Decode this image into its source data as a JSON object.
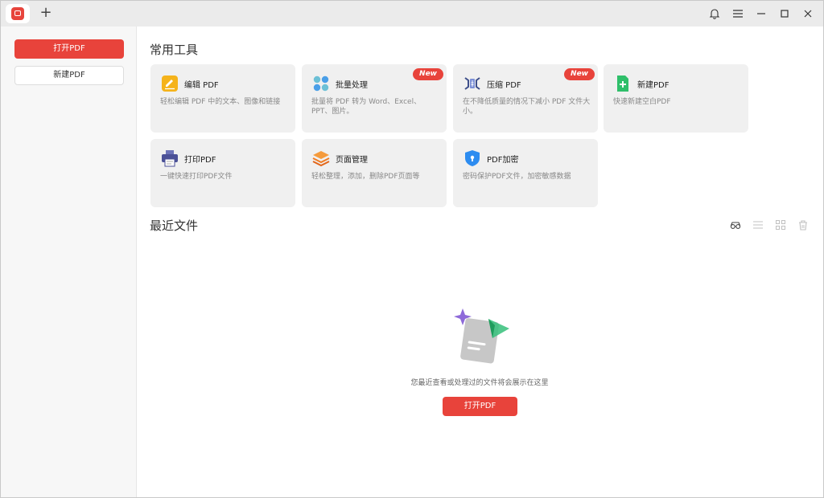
{
  "titlebar": {
    "new_tab": "+"
  },
  "sidebar": {
    "open_pdf": "打开PDF",
    "new_pdf": "新建PDF"
  },
  "tools": {
    "heading": "常用工具",
    "items": [
      {
        "title": "编辑 PDF",
        "desc": "轻松编辑 PDF 中的文本、图像和链接",
        "badge": ""
      },
      {
        "title": "批量处理",
        "desc": "批量将 PDF 转为 Word、Excel、PPT、图片。",
        "badge": "New"
      },
      {
        "title": "压缩 PDF",
        "desc": "在不降低质量的情况下减小 PDF 文件大小。",
        "badge": "New"
      },
      {
        "title": "新建PDF",
        "desc": "快速新建空白PDF",
        "badge": ""
      },
      {
        "title": "打印PDF",
        "desc": "一键快速打印PDF文件",
        "badge": ""
      },
      {
        "title": "页面管理",
        "desc": "轻松整理，添加，删除PDF页面等",
        "badge": ""
      },
      {
        "title": "PDF加密",
        "desc": "密码保护PDF文件，加密敏感数据",
        "badge": ""
      }
    ]
  },
  "recent": {
    "heading": "最近文件",
    "empty_text": "您最近查看或处理过的文件将会展示在这里",
    "open_button": "打开PDF"
  },
  "colors": {
    "accent": "#e8433b",
    "card_bg": "#f0f0f0",
    "sidebar_bg": "#f7f7f7"
  }
}
